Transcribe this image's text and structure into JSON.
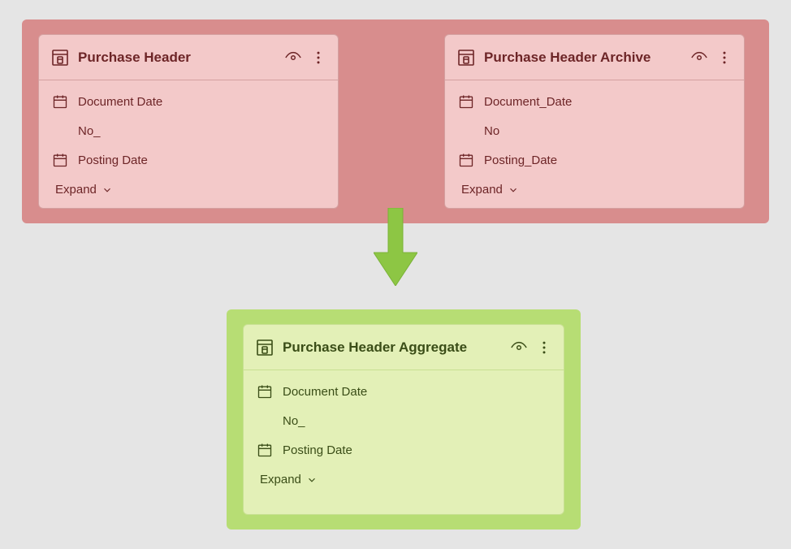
{
  "colors": {
    "top_group_bg": "#d88d8d",
    "bottom_group_bg": "#b7dd74",
    "red_card_bg": "#f3c9c9",
    "red_text": "#6d2527",
    "green_card_bg": "#e3f0b7",
    "green_text": "#3a4d17",
    "arrow": "#8dc63f"
  },
  "top": {
    "left": {
      "title": "Purchase Header",
      "fields": [
        {
          "icon": "calendar",
          "label": "Document Date"
        },
        {
          "icon": null,
          "label": "No_"
        },
        {
          "icon": "calendar",
          "label": "Posting Date"
        }
      ],
      "expand": "Expand"
    },
    "right": {
      "title": "Purchase Header Archive",
      "fields": [
        {
          "icon": "calendar",
          "label": "Document_Date"
        },
        {
          "icon": null,
          "label": "No"
        },
        {
          "icon": "calendar",
          "label": "Posting_Date"
        }
      ],
      "expand": "Expand"
    }
  },
  "bottom": {
    "title": "Purchase Header Aggregate",
    "fields": [
      {
        "icon": "calendar",
        "label": "Document Date"
      },
      {
        "icon": null,
        "label": "No_"
      },
      {
        "icon": "calendar",
        "label": "Posting Date"
      }
    ],
    "expand": "Expand"
  }
}
